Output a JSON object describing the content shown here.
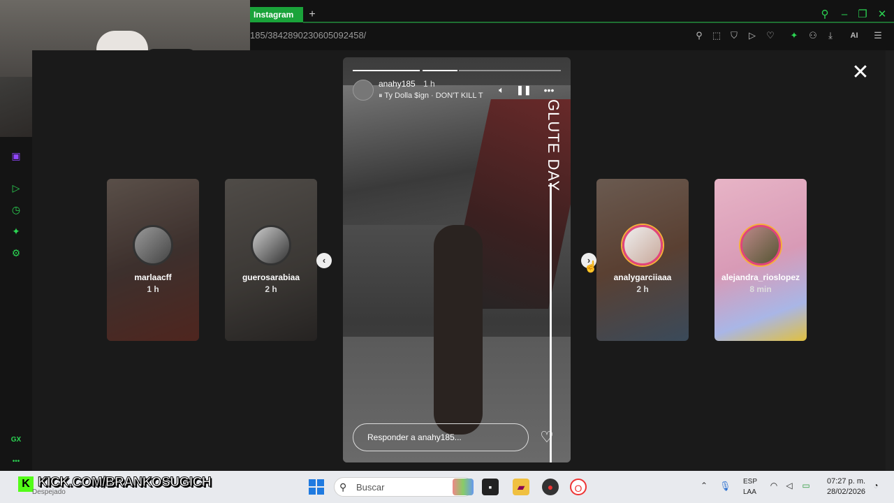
{
  "browser": {
    "tab_label": "Instagram",
    "new_tab": "+",
    "url": "185/3842890230605092458/",
    "ai_label": "AI"
  },
  "sidebar": {
    "bottom_label": "GX",
    "more": "•••"
  },
  "stories": {
    "left": [
      {
        "username": "marlaacff",
        "time": "1 h"
      },
      {
        "username": "guerosarabiaa",
        "time": "2 h"
      }
    ],
    "right": [
      {
        "username": "analygarciiaaa",
        "time": "2 h"
      },
      {
        "username": "alejandra_rioslopez",
        "time": "8 min"
      }
    ],
    "main": {
      "username": "anahy185",
      "time": "1 h",
      "music": "Ty Dolla $ign · DON'T KILL T",
      "sticker_text": "GLUTE DAY",
      "reply_placeholder": "Responder a anahy185...",
      "progress_segments": 3,
      "progress_done": 2
    }
  },
  "taskbar": {
    "stream_overlay": "KICK.COM/BRANKOSUGICH",
    "weather": "Despejado",
    "search_placeholder": "Buscar",
    "lang_top": "ESP",
    "lang_bottom": "LAA",
    "time": "07:27 p. m.",
    "date": "28/02/2026"
  },
  "colors": {
    "accent": "#2bd452",
    "tab": "#1aa33a",
    "kick": "#53fc18"
  }
}
